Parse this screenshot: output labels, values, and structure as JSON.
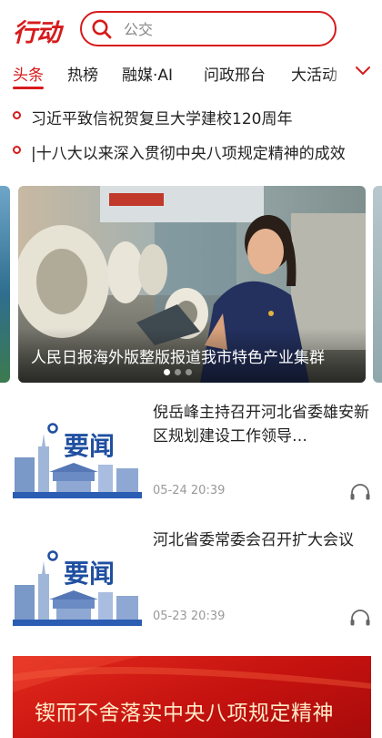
{
  "header": {
    "logo_text": "行动",
    "search_placeholder": "公交"
  },
  "tabs": [
    "头条",
    "热榜",
    "融媒·AI",
    "问政邢台",
    "大活动"
  ],
  "active_tab": "头条",
  "headlines": [
    "习近平致信祝贺复旦大学建校120周年",
    "|十八大以来深入贯彻中央八项规定精神的成效"
  ],
  "carousel": {
    "caption": "人民日报海外版整版报道我市特色产业集群",
    "slide_count": 3,
    "active_index": 0
  },
  "news": [
    {
      "thumb_label": "要闻",
      "title": "倪岳峰主持召开河北省委雄安新区规划建设工作领导…",
      "time": "05-24 20:39"
    },
    {
      "thumb_label": "要闻",
      "title": "河北省委常委会召开扩大会议",
      "time": "05-23 20:39"
    }
  ],
  "banner": {
    "text": "锲而不舍落实中央八项规定精神"
  },
  "colors": {
    "brand_red": "#d71a1b",
    "thumb_blue": "#1f4fa0"
  }
}
